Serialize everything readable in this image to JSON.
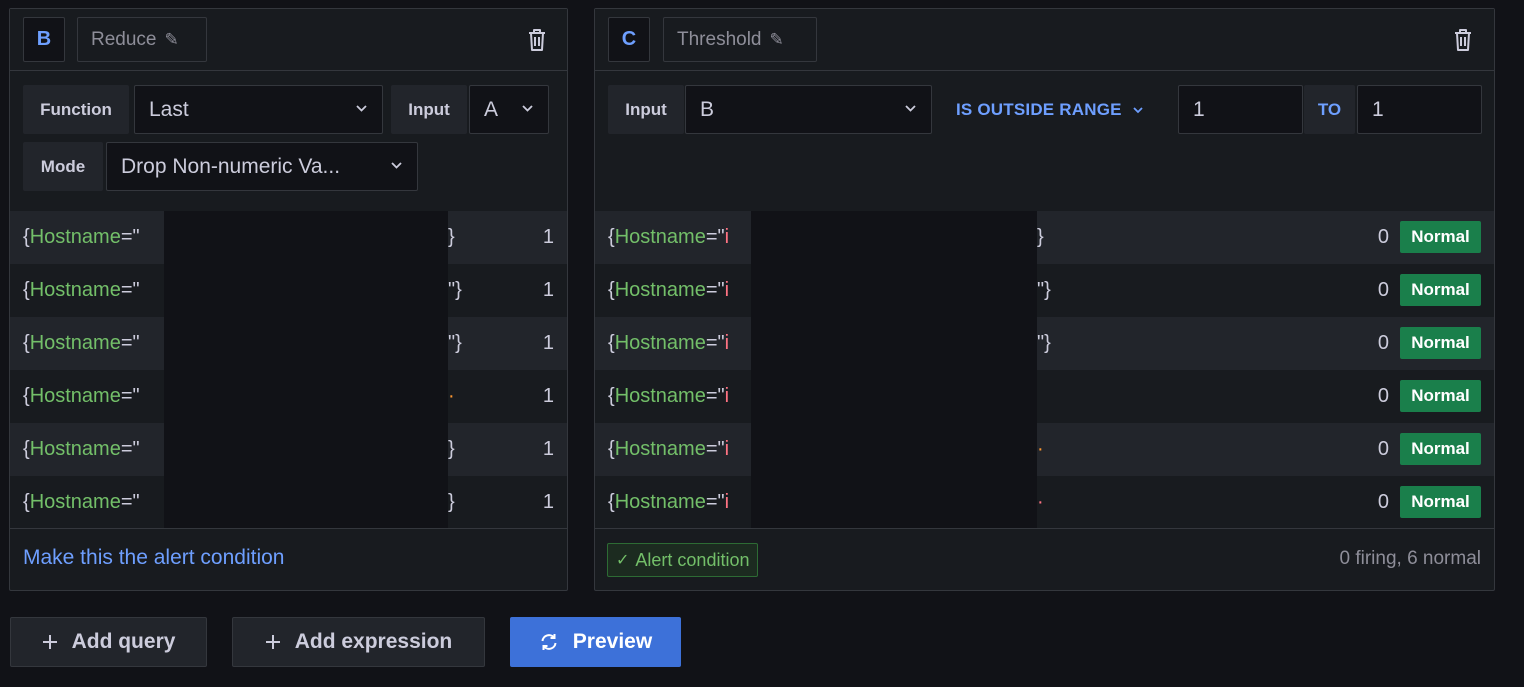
{
  "reduce": {
    "ref_id": "B",
    "name": "Reduce",
    "function_label": "Function",
    "function_value": "Last",
    "input_label": "Input",
    "input_value": "A",
    "mode_label": "Mode",
    "mode_value": "Drop Non-numeric Va...",
    "rows": [
      {
        "open": "{",
        "key": "Hostname",
        "eq": "=\"",
        "tail": "}",
        "value": "1"
      },
      {
        "open": "{",
        "key": "Hostname",
        "eq": "=\"",
        "tail": "\"}",
        "value": "1"
      },
      {
        "open": "{",
        "key": "Hostname",
        "eq": "=\"",
        "tail": "\"}",
        "value": "1"
      },
      {
        "open": "{",
        "key": "Hostname",
        "eq": "=\"",
        "tail": "·",
        "value": "1"
      },
      {
        "open": "{",
        "key": "Hostname",
        "eq": "=\"",
        "tail": "}",
        "value": "1"
      },
      {
        "open": "{",
        "key": "Hostname",
        "eq": "=\"",
        "tail": "}",
        "value": "1"
      }
    ],
    "footer_link": "Make this the alert condition"
  },
  "threshold": {
    "ref_id": "C",
    "name": "Threshold",
    "input_label": "Input",
    "input_value": "B",
    "condition": "IS OUTSIDE RANGE",
    "from_value": "1",
    "to_label": "TO",
    "to_value": "1",
    "rows": [
      {
        "open": "{",
        "key": "Hostname",
        "eq": "=\"",
        "vstart": "i",
        "tail": "}",
        "value": "0",
        "state": "Normal"
      },
      {
        "open": "{",
        "key": "Hostname",
        "eq": "=\"",
        "vstart": "i",
        "tail": "\"}",
        "value": "0",
        "state": "Normal"
      },
      {
        "open": "{",
        "key": "Hostname",
        "eq": "=\"",
        "vstart": "i",
        "tail": "\"}",
        "value": "0",
        "state": "Normal"
      },
      {
        "open": "{",
        "key": "Hostname",
        "eq": "=\"",
        "vstart": "i",
        "tail": "",
        "value": "0",
        "state": "Normal"
      },
      {
        "open": "{",
        "key": "Hostname",
        "eq": "=\"",
        "vstart": "i",
        "tail": "·",
        "value": "0",
        "state": "Normal"
      },
      {
        "open": "{",
        "key": "Hostname",
        "eq": "=\"",
        "vstart": "i",
        "tail": "·",
        "value": "0",
        "state": "Normal"
      }
    ],
    "condition_badge": "Alert condition",
    "summary": "0 firing, 6 normal"
  },
  "actions": {
    "add_query": "Add query",
    "add_expression": "Add expression",
    "preview": "Preview"
  },
  "colors": {
    "background": "#111217",
    "panel": "#181b1f",
    "accent_blue": "#6e9fff",
    "primary_button": "#3d71d9",
    "label_green": "#73bf69",
    "normal_badge": "#1a7f4b"
  },
  "icons": {
    "edit": "pencil-icon",
    "delete": "trash-icon",
    "dropdown": "chevron-down-icon",
    "add": "plus-icon",
    "refresh": "sync-icon",
    "check": "check-icon"
  }
}
